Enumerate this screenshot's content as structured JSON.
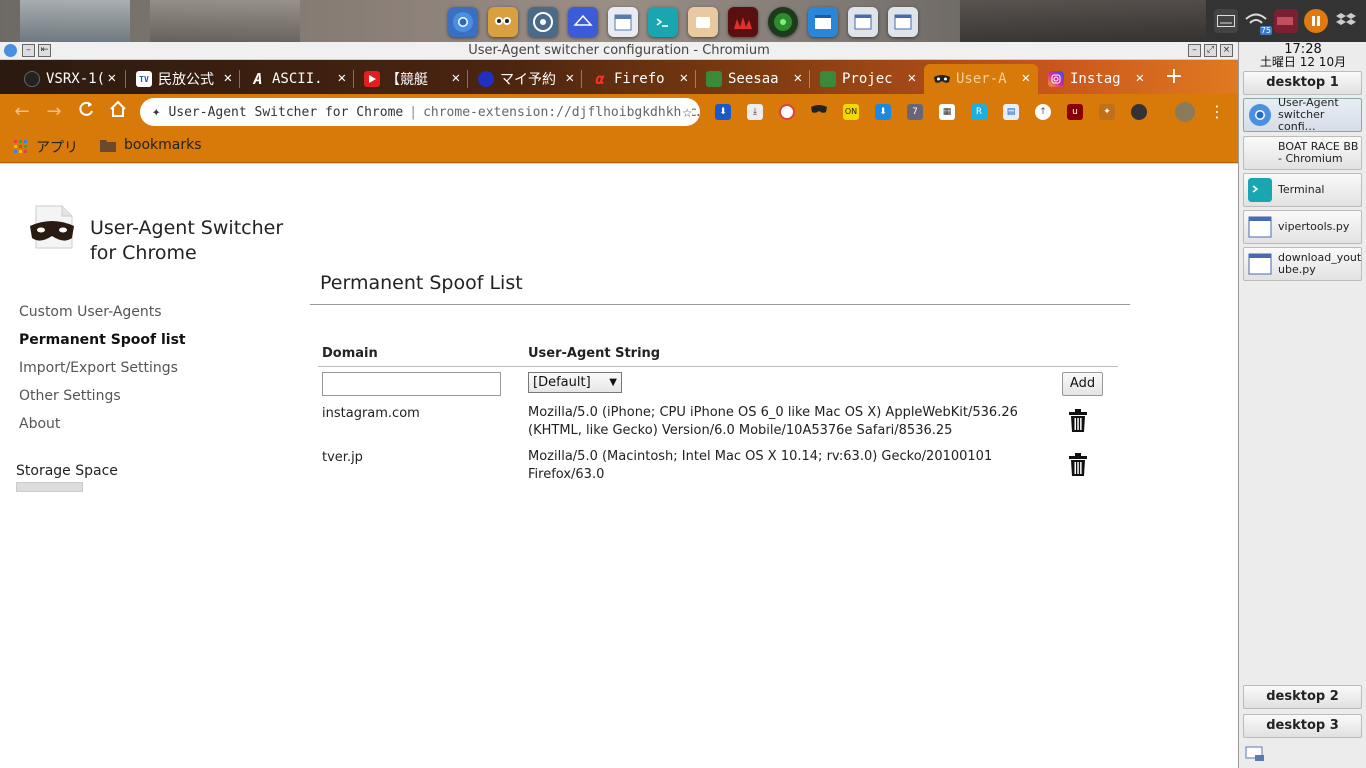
{
  "window": {
    "title": "User-Agent switcher configuration - Chromium"
  },
  "tabs": [
    {
      "label": "VSRX-1(",
      "icon": "vsrx-icon"
    },
    {
      "label": "民放公式",
      "icon": "tver-icon"
    },
    {
      "label": "ASCII.",
      "icon": "ascii-icon"
    },
    {
      "label": "【競艇",
      "icon": "youtube-icon"
    },
    {
      "label": "マイ予約",
      "icon": "myyoyaku-icon"
    },
    {
      "label": "Firefo",
      "icon": "alpha-icon"
    },
    {
      "label": "Seesaa",
      "icon": "seesaa-icon"
    },
    {
      "label": "Projec",
      "icon": "project-icon"
    },
    {
      "label": "User-A",
      "icon": "mask-icon"
    },
    {
      "label": "Instag",
      "icon": "instagram-icon"
    }
  ],
  "omnibox": {
    "site_label": "User-Agent Switcher for Chrome",
    "url": "chrome-extension://djflhoibgkdhkhhc…"
  },
  "bookmarks": {
    "apps_label": "アプリ",
    "folder_label": "bookmarks"
  },
  "extension": {
    "name_line1": "User-Agent Switcher",
    "name_line2": "for Chrome"
  },
  "sidenav": [
    {
      "label": "Custom User-Agents",
      "active": false
    },
    {
      "label": "Permanent Spoof list",
      "active": true
    },
    {
      "label": "Import/Export Settings",
      "active": false
    },
    {
      "label": "Other Settings",
      "active": false
    },
    {
      "label": "About",
      "active": false
    }
  ],
  "storage": {
    "label": "Storage Space",
    "used_fraction": 0.0
  },
  "panel": {
    "title": "Permanent Spoof List",
    "col_domain": "Domain",
    "col_ua": "User-Agent String",
    "domain_input_value": "",
    "ua_select_value": "[Default]",
    "add_label": "Add"
  },
  "rows": [
    {
      "domain": "instagram.com",
      "ua_line1": "Mozilla/5.0 (iPhone; CPU iPhone OS 6_0 like Mac OS X) AppleWebKit/536.26",
      "ua_line2": "(KHTML, like Gecko) Version/6.0 Mobile/10A5376e Safari/8536.25"
    },
    {
      "domain": "tver.jp",
      "ua_line1": "Mozilla/5.0 (Macintosh; Intel Mac OS X 10.14; rv:63.0) Gecko/20100101",
      "ua_line2": "Firefox/63.0"
    }
  ],
  "taskpanel": {
    "time": "17:28",
    "date": "土曜日 12 10月",
    "desktop1": "desktop 1",
    "desktop2": "desktop 2",
    "desktop3": "desktop 3",
    "tasks": [
      {
        "label_line1": "User-Agent",
        "label_line2": "switcher confi…"
      },
      {
        "label_line1": "BOAT RACE BB",
        "label_line2": "- Chromium"
      },
      {
        "label_line1": "Terminal",
        "label_line2": ""
      },
      {
        "label_line1": "vipertools.py",
        "label_line2": ""
      },
      {
        "label_line1": "download_yout",
        "label_line2": "ube.py"
      }
    ]
  },
  "tray": {
    "wifi_badge": "75"
  },
  "colors": {
    "chrome_orange": "#d87a0a",
    "page_bg": "#ffffff"
  }
}
